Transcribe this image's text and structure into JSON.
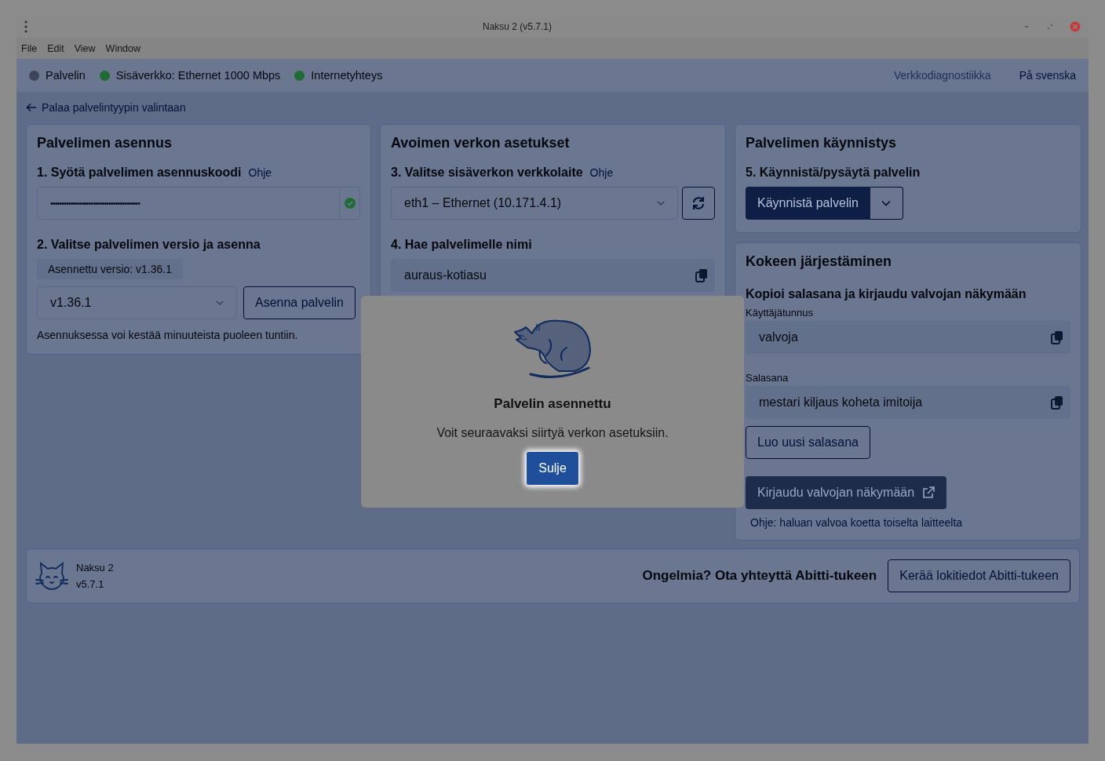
{
  "window": {
    "title": "Naksu 2 (v5.7.1)"
  },
  "menu": [
    "File",
    "Edit",
    "View",
    "Window"
  ],
  "status": {
    "items": [
      {
        "label": "Palvelin",
        "color": "#3c4556"
      },
      {
        "label": "Sisäverkko: Ethernet 1000 Mbps",
        "color": "#1e6b34"
      },
      {
        "label": "Internetyhteys",
        "color": "#1e6b34"
      }
    ],
    "links": [
      {
        "label": "Verkkodiagnostiikka",
        "disabled": true
      },
      {
        "label": "På svenska",
        "disabled": false
      }
    ]
  },
  "back_link": "Palaa palvelintyypin valintaan",
  "install": {
    "title": "Palvelimen asennus",
    "step1_label": "1. Syötä palvelimen asennuskoodi",
    "step1_help": "Ohje",
    "code": "••••••••••••••••••••••••••••••••••••••••",
    "code_valid": true,
    "step2_label": "2. Valitse palvelimen versio ja asenna",
    "installed": "Asennettu versio: v1.36.1",
    "version": "v1.36.1",
    "install_button": "Asenna palvelin",
    "note": "Asennuksessa voi kestää minuuteista puoleen tuntiin."
  },
  "network": {
    "title": "Avoimen verkon asetukset",
    "step3_label": "3. Valitse sisäverkon verkkolaite",
    "step3_help": "Ohje",
    "device": "eth1 – Ethernet (10.171.4.1)",
    "step4_label": "4. Hae palvelimelle nimi",
    "server_name": "auraus-kotiasu"
  },
  "startup": {
    "title": "Palvelimen käynnistys",
    "step5_label": "5. Käynnistä/pysäytä palvelin",
    "start_button": "Käynnistä palvelin"
  },
  "exam": {
    "title": "Kokeen järjestäminen",
    "subtitle": "Kopioi salasana ja kirjaudu valvojan näkymään",
    "username_label": "Käyttäjätunnus",
    "username": "valvoja",
    "password_label": "Salasana",
    "password": "mestari kiljaus koheta imitoija",
    "new_password_button": "Luo uusi salasana",
    "login": {
      "label": "Kirjaudu valvojan näkymään",
      "disabled": true
    },
    "help_link": "Ohje: haluan valvoa koetta toiselta laitteelta"
  },
  "footer": {
    "app_name": "Naksu 2",
    "app_version": "v5.7.1",
    "support_text": "Ongelmia? Ota yhteyttä Abitti-tukeen",
    "logs_button": "Kerää lokitiedot Abitti-tukeen"
  },
  "dialog": {
    "title": "Palvelin asennettu",
    "message": "Voit seuraavaksi siirtyä verkon asetuksiin.",
    "close_button": "Sulje"
  }
}
